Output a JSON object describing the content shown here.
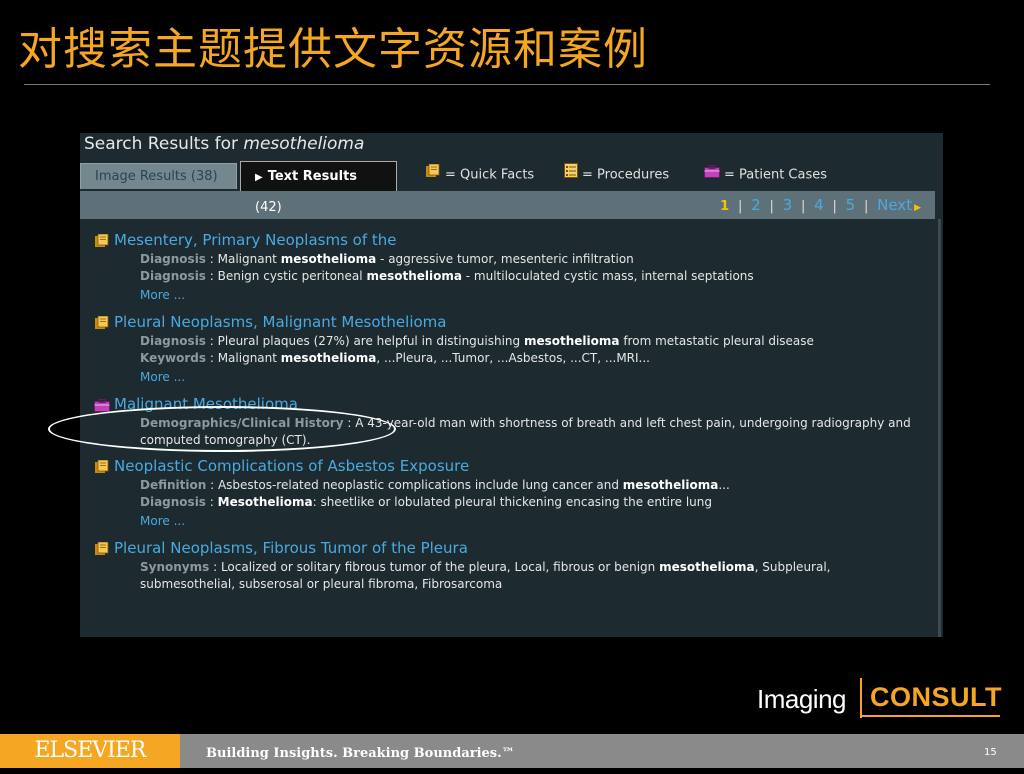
{
  "slide": {
    "title": "对搜索主题提供文字资源和案例",
    "page_number": "15"
  },
  "search": {
    "heading_prefix": "Search Results for",
    "query": "mesothelioma"
  },
  "tabs": [
    {
      "label": "Image Results (38)"
    },
    {
      "label_bold": "Text Results",
      "label_count": "(42)"
    }
  ],
  "legend": [
    {
      "icon": "quick-facts-icon",
      "label": "= Quick Facts",
      "color": "#f0c419"
    },
    {
      "icon": "procedures-icon",
      "label": "= Procedures",
      "color": "#f0c419"
    },
    {
      "icon": "patient-cases-icon",
      "label": "= Patient Cases",
      "color": "#c044b8"
    }
  ],
  "pager": {
    "current": "1",
    "pages": [
      "2",
      "3",
      "4",
      "5"
    ],
    "separator": "|",
    "next": "Next"
  },
  "results": [
    {
      "icon": "quick-facts-icon",
      "title": "Mesentery, Primary Neoplasms of the",
      "lines": [
        {
          "label": "Diagnosis",
          "sep": " : ",
          "pre": "Malignant ",
          "term": "mesothelioma",
          "post": " - aggressive tumor, mesenteric infiltration"
        },
        {
          "label": "Diagnosis",
          "sep": " : ",
          "pre": "Benign cystic peritoneal ",
          "term": "mesothelioma",
          "post": " - multiloculated cystic mass, internal septations"
        }
      ],
      "more": "More ..."
    },
    {
      "icon": "quick-facts-icon",
      "title": "Pleural Neoplasms, Malignant Mesothelioma",
      "lines": [
        {
          "label": "Diagnosis",
          "sep": " : ",
          "pre": "Pleural plaques (27%) are helpful in distinguishing ",
          "term": "mesothelioma",
          "post": " from metastatic pleural disease"
        },
        {
          "label": "Keywords",
          "sep": " : ",
          "pre": "Malignant ",
          "term": "mesothelioma",
          "post": ", ...Pleura, ...Tumor, ...Asbestos, ...CT, ...MRI..."
        }
      ],
      "more": "More ..."
    },
    {
      "icon": "patient-cases-icon",
      "title": "Malignant Mesothelioma",
      "lines": [
        {
          "label": "Demographics/Clinical History",
          "sep": " : ",
          "pre": "A 43-year-old man with shortness of breath and left chest pain, undergoing radiography and computed tomography (CT).",
          "term": "",
          "post": ""
        }
      ],
      "more": ""
    },
    {
      "icon": "quick-facts-icon",
      "title": "Neoplastic Complications of Asbestos Exposure",
      "lines": [
        {
          "label": "Definition",
          "sep": " : ",
          "pre": "Asbestos-related neoplastic complications include lung cancer and ",
          "term": "mesothelioma",
          "post": "..."
        },
        {
          "label": "Diagnosis",
          "sep": " : ",
          "pre": "",
          "term": "Mesothelioma",
          "post": ": sheetlike or lobulated pleural thickening encasing the entire lung"
        }
      ],
      "more": "More ..."
    },
    {
      "icon": "quick-facts-icon",
      "title": "Pleural Neoplasms, Fibrous Tumor of the Pleura",
      "lines": [
        {
          "label": "Synonyms",
          "sep": " : ",
          "pre": "Localized or solitary fibrous tumor of the pleura, Local, fibrous or benign ",
          "term": "mesothelioma",
          "post": ", Subpleural, submesothelial, subserosal or pleural fibroma, Fibrosarcoma"
        }
      ],
      "more": ""
    }
  ],
  "logo": {
    "imaging": "Imaging",
    "consult": "CONSULT"
  },
  "footer": {
    "brand": "ELSEVIER",
    "tagline": "Building Insights. Breaking Boundaries.™"
  }
}
